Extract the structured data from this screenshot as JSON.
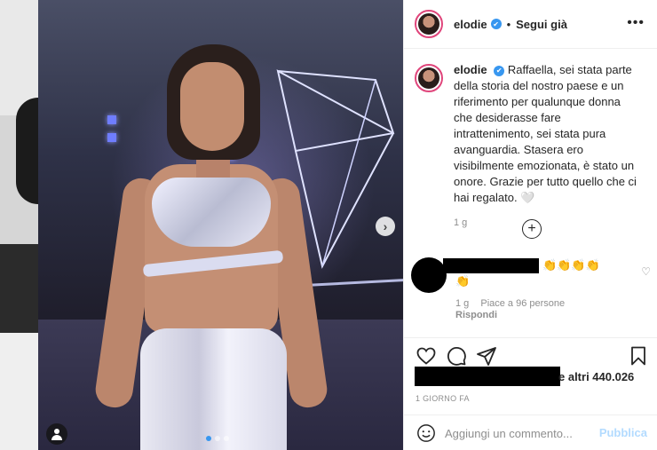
{
  "post": {
    "username": "elodie",
    "verified_mark": "✔",
    "separator": "•",
    "follow_label": "Segui già",
    "more_label": "•••",
    "next_label": "›"
  },
  "caption": {
    "username": "elodie",
    "text": "Raffaella, sei stata parte della storia del nostro paese e un riferimento per qualunque donna che desiderasse fare intrattenimento, sei stata pura avanguardia. Stasera ero visibilmente emozionata, è stato un onore. Grazie per tutto quello che ci hai regalato. 🤍",
    "time": "1 g"
  },
  "load_more": {
    "label": "+"
  },
  "comment": {
    "claps_line1": "👏👏👏👏",
    "claps_line2": "👏",
    "heart": "♡",
    "time": "1 g",
    "likes": "Piace a 96 persone",
    "reply_label": "Rispondi"
  },
  "likes": {
    "suffix": "e altri 440.026"
  },
  "timestamp": "1 GIORNO FA",
  "comment_box": {
    "placeholder": "Aggiungi un commento...",
    "publish_label": "Pubblica"
  },
  "icons": {
    "heart": "heart-icon",
    "comment": "comment-icon",
    "share": "share-icon",
    "save": "bookmark-icon",
    "emoji": "emoji-icon"
  },
  "colors": {
    "verified": "#3897f0",
    "publish_disabled": "#b3dbff",
    "story_ring": "#e0457b",
    "active_dot": "#3897f0"
  }
}
